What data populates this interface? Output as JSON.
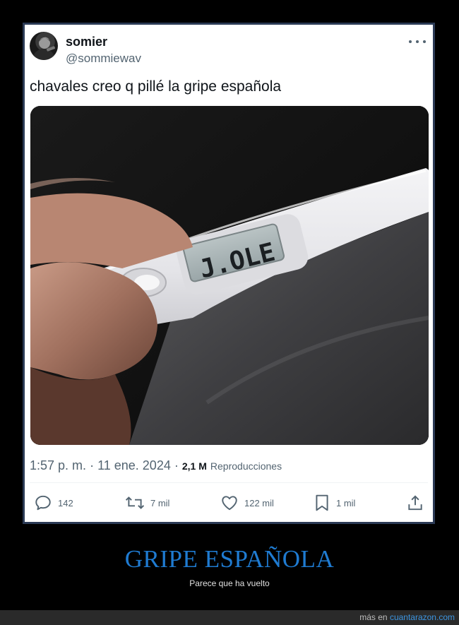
{
  "tweet": {
    "author_name": "somier",
    "author_handle": "@sommiewav",
    "text": "chavales creo q pillé la gripe española",
    "thermometer_display": "J.OLE",
    "time": "1:57 p. m.",
    "separator": "·",
    "date": "11 ene. 2024",
    "views_count": "2,1 M",
    "views_label": "Reproducciones",
    "actions": {
      "replies": "142",
      "retweets": "7 mil",
      "likes": "122 mil",
      "bookmarks": "1 mil"
    },
    "icons": [
      "more-icon",
      "reply-icon",
      "retweet-icon",
      "like-icon",
      "bookmark-icon",
      "share-icon"
    ]
  },
  "caption": {
    "title": "GRIPE ESPAÑOLA",
    "subtitle": "Parece que ha vuelto"
  },
  "footer": {
    "prefix": "más en",
    "site": "cuantarazon.com"
  },
  "colors": {
    "frame": "#2b3a55",
    "caption_title": "#1f7bd1",
    "footer_link": "#3d95e0",
    "muted_text": "#536471"
  }
}
